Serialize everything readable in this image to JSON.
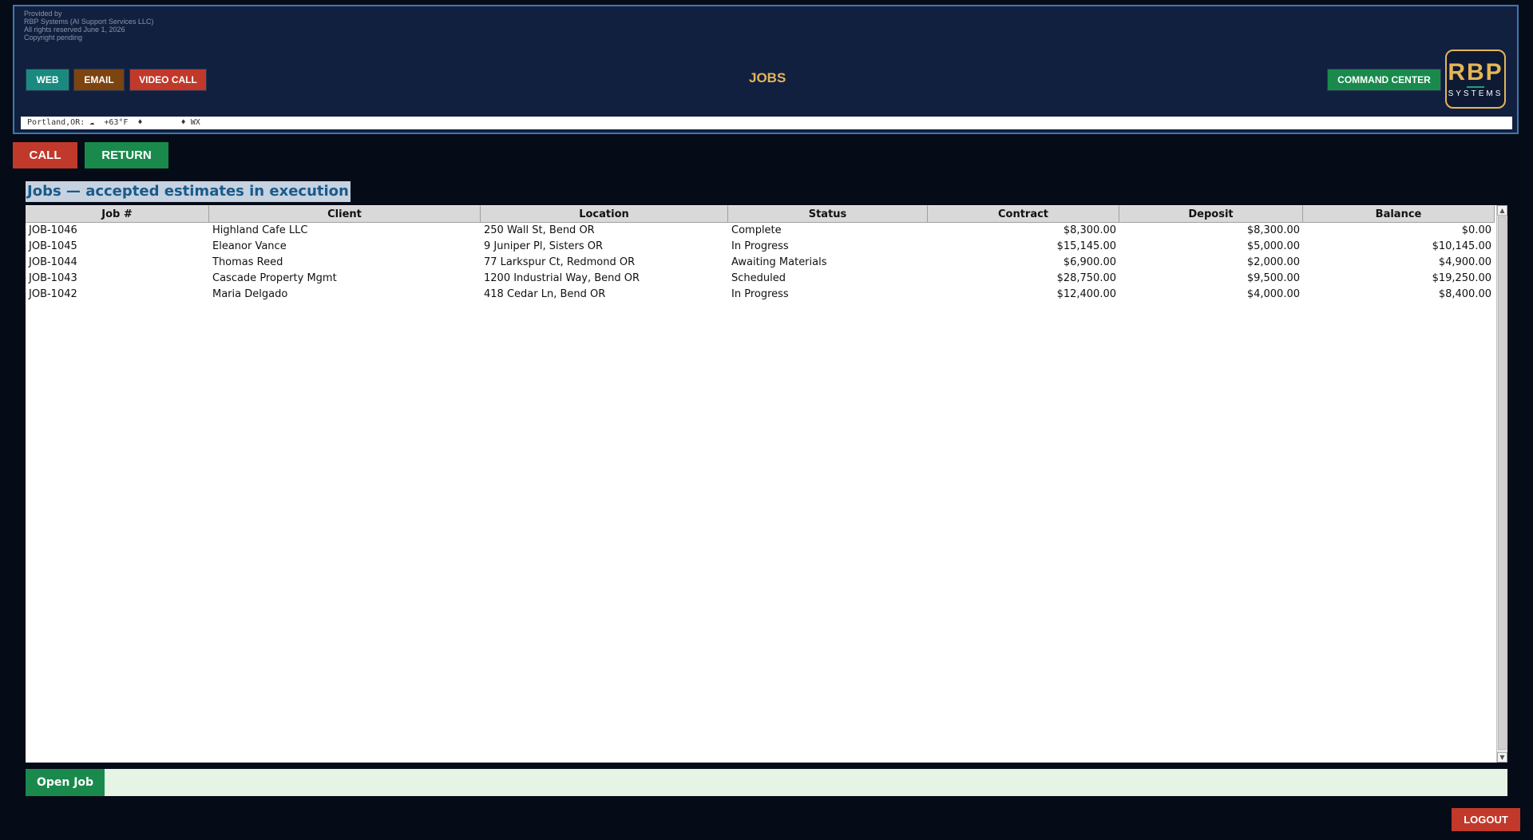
{
  "header": {
    "provided": [
      "Provided by",
      "RBP Systems (AI Support Services LLC)",
      "All rights reserved  June 1, 2026",
      "Copyright pending"
    ],
    "buttons": {
      "web": "WEB",
      "email": "EMAIL",
      "video_call": "VIDEO CALL",
      "command_center": "COMMAND CENTER"
    },
    "title": "JOBS",
    "logo": {
      "main": "RBP",
      "sub": "SYSTEMS"
    },
    "weather": "Portland,OR: ☁  +63°F  ♦        ♦ WX"
  },
  "actions": {
    "call": "CALL",
    "return": "RETURN"
  },
  "section_title": "Jobs — accepted estimates in execution",
  "table": {
    "columns": [
      "Job #",
      "Client",
      "Location",
      "Status",
      "Contract",
      "Deposit",
      "Balance"
    ],
    "rows": [
      [
        "JOB-1046",
        "Highland Cafe LLC",
        "250 Wall St, Bend OR",
        "Complete",
        "$8,300.00",
        "$8,300.00",
        "$0.00"
      ],
      [
        "JOB-1045",
        "Eleanor Vance",
        "9 Juniper Pl, Sisters OR",
        "In Progress",
        "$15,145.00",
        "$5,000.00",
        "$10,145.00"
      ],
      [
        "JOB-1044",
        "Thomas Reed",
        "77 Larkspur Ct, Redmond OR",
        "Awaiting Materials",
        "$6,900.00",
        "$2,000.00",
        "$4,900.00"
      ],
      [
        "JOB-1043",
        "Cascade Property Mgmt",
        "1200 Industrial Way, Bend OR",
        "Scheduled",
        "$28,750.00",
        "$9,500.00",
        "$19,250.00"
      ],
      [
        "JOB-1042",
        "Maria Delgado",
        "418 Cedar Ln, Bend OR",
        "In Progress",
        "$12,400.00",
        "$4,000.00",
        "$8,400.00"
      ]
    ]
  },
  "footer": {
    "open_job": "Open Job",
    "logout": "LOGOUT"
  },
  "colors": {
    "accent_gold": "#e4b558",
    "red": "#c0392b",
    "green": "#198a4c",
    "teal": "#1a8a80",
    "brown": "#7c4410",
    "header_bg": "#122040"
  },
  "icons": {
    "weather": "cloud-icon",
    "scroll_up": "arrow-up-icon",
    "scroll_down": "arrow-down-icon"
  }
}
